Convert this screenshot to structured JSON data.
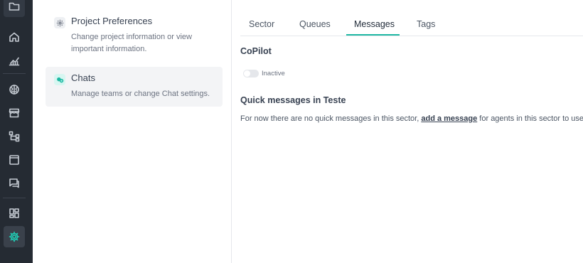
{
  "sidebar": {
    "icons": [
      {
        "name": "folder-icon"
      },
      {
        "name": "home-icon"
      },
      {
        "name": "insights-icon"
      },
      {
        "name": "brain-icon"
      },
      {
        "name": "store-icon"
      },
      {
        "name": "flows-icon"
      },
      {
        "name": "window-icon"
      },
      {
        "name": "chat-icon"
      },
      {
        "name": "dashboard-icon"
      },
      {
        "name": "settings-icon",
        "active": true
      }
    ],
    "accent_color": "#1fd1b8",
    "background_color": "#252b33"
  },
  "settings_list": {
    "items": [
      {
        "title": "Project Preferences",
        "description": "Change project information or view important information.",
        "icon": "gear-icon",
        "selected": false
      },
      {
        "title": "Chats",
        "description": "Manage teams or change Chat settings.",
        "icon": "chats-icon",
        "selected": true
      }
    ]
  },
  "tabs": [
    {
      "label": "Sector",
      "active": false
    },
    {
      "label": "Queues",
      "active": false
    },
    {
      "label": "Messages",
      "active": true
    },
    {
      "label": "Tags",
      "active": false
    }
  ],
  "copilot": {
    "title": "CoPilot",
    "toggle_state": "Inactive",
    "enabled": false
  },
  "quick_messages": {
    "title": "Quick messages in Teste",
    "text_before": "For now there are no quick messages in this sector,",
    "link_text": "add a message",
    "text_after": "for agents in this sector to use."
  },
  "colors": {
    "tab_underline": "#1fb8a3"
  }
}
